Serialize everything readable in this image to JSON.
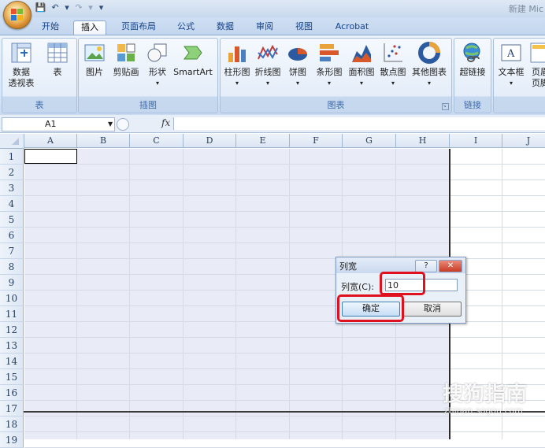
{
  "window": {
    "title": "新建 Mic"
  },
  "quick_access": {
    "save": "💾",
    "undo": "↶",
    "redo": "↷",
    "more": "▾"
  },
  "tabs": [
    "开始",
    "插入",
    "页面布局",
    "公式",
    "数据",
    "审阅",
    "视图",
    "Acrobat"
  ],
  "active_tab": "插入",
  "ribbon": {
    "groups": [
      {
        "title": "表",
        "buttons": [
          "数据\n透视表",
          "表"
        ]
      },
      {
        "title": "插图",
        "buttons": [
          "图片",
          "剪贴画",
          "形状",
          "SmartArt"
        ]
      },
      {
        "title": "图表",
        "buttons": [
          "柱形图",
          "折线图",
          "饼图",
          "条形图",
          "面积图",
          "散点图",
          "其他图表"
        ]
      },
      {
        "title": "链接",
        "buttons": [
          "超链接"
        ]
      },
      {
        "title": "",
        "buttons": [
          "文本框",
          "页眉"
        ]
      }
    ],
    "labels": {
      "pivot_line1": "数据",
      "pivot_line2": "透视表",
      "table": "表",
      "picture": "图片",
      "clipart": "剪贴画",
      "shapes": "形状",
      "smartart": "SmartArt",
      "column": "柱形图",
      "line": "折线图",
      "pie": "饼图",
      "bar": "条形图",
      "area": "面积图",
      "scatter": "散点图",
      "other": "其他图表",
      "hyperlink": "超链接",
      "textbox": "文本框",
      "header_line1": "页眉",
      "header_line2": "页脚"
    },
    "group_titles": {
      "tables": "表",
      "illustrations": "插图",
      "charts": "图表",
      "links": "链接"
    }
  },
  "formula_bar": {
    "name_box": "A1",
    "fx": "fx",
    "formula": ""
  },
  "columns": [
    "A",
    "B",
    "C",
    "D",
    "E",
    "F",
    "G",
    "H",
    "I",
    "J"
  ],
  "selected_columns": [
    "A",
    "B",
    "C",
    "D",
    "E",
    "F",
    "G",
    "H"
  ],
  "rows": [
    "1",
    "2",
    "3",
    "4",
    "5",
    "6",
    "7",
    "8",
    "9",
    "10",
    "11",
    "12",
    "13",
    "14",
    "15",
    "16",
    "17",
    "18",
    "19"
  ],
  "dialog": {
    "title": "列宽",
    "help": "?",
    "close": "✕",
    "label": "列宽(C):",
    "value": "10",
    "ok": "确定",
    "cancel": "取消"
  },
  "watermark": {
    "text": "搜狗指南",
    "url": "zhinan.sogou.com"
  },
  "colors": {
    "accent": "#15428b",
    "highlight": "#e0111f",
    "selection": "#e9ecf6"
  }
}
